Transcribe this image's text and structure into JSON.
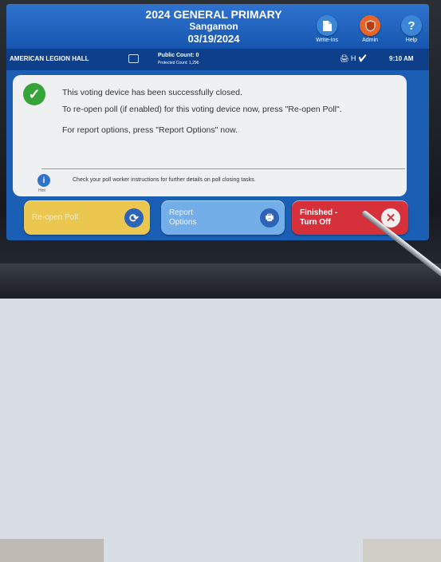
{
  "header": {
    "title_line1": "2024 GENERAL PRIMARY",
    "title_line2": "Sangamon",
    "title_line3": "03/19/2024",
    "buttons": [
      {
        "label": "Write-Ins",
        "icon": "document-icon",
        "color": "#3b86d6"
      },
      {
        "label": "Admin",
        "icon": "shield-icon",
        "color": "#e7652a"
      },
      {
        "label": "Help",
        "icon": "help-icon",
        "color": "#3b86d6"
      }
    ]
  },
  "infobar": {
    "location": "AMERICAN LEGION HALL",
    "public_count": "Public Count: 0",
    "protected_count": "Protected Count: 1,296",
    "status_icons": "🖨 H ✔",
    "time": "9:10 AM"
  },
  "message": {
    "line1": "This voting device has been successfully closed.",
    "line2": "To re-open poll (if enabled) for this voting device now, press \"Re-open Poll\".",
    "line3": "For report options, press \"Report Options\" now.",
    "hint_label": "Hint",
    "hint_text": "Check your poll worker instructions for further details on poll closing tasks."
  },
  "actions": {
    "reopen": "Re-open Poll",
    "report_line1": "Report",
    "report_line2": "Options",
    "finish_line1": "Finished -",
    "finish_line2": "Turn Off"
  },
  "colors": {
    "header_blue": "#1a5fb4",
    "reopen_yellow": "#ecc74f",
    "report_blue": "#74aee8",
    "finish_red": "#d6303a",
    "check_green": "#37a43a"
  }
}
